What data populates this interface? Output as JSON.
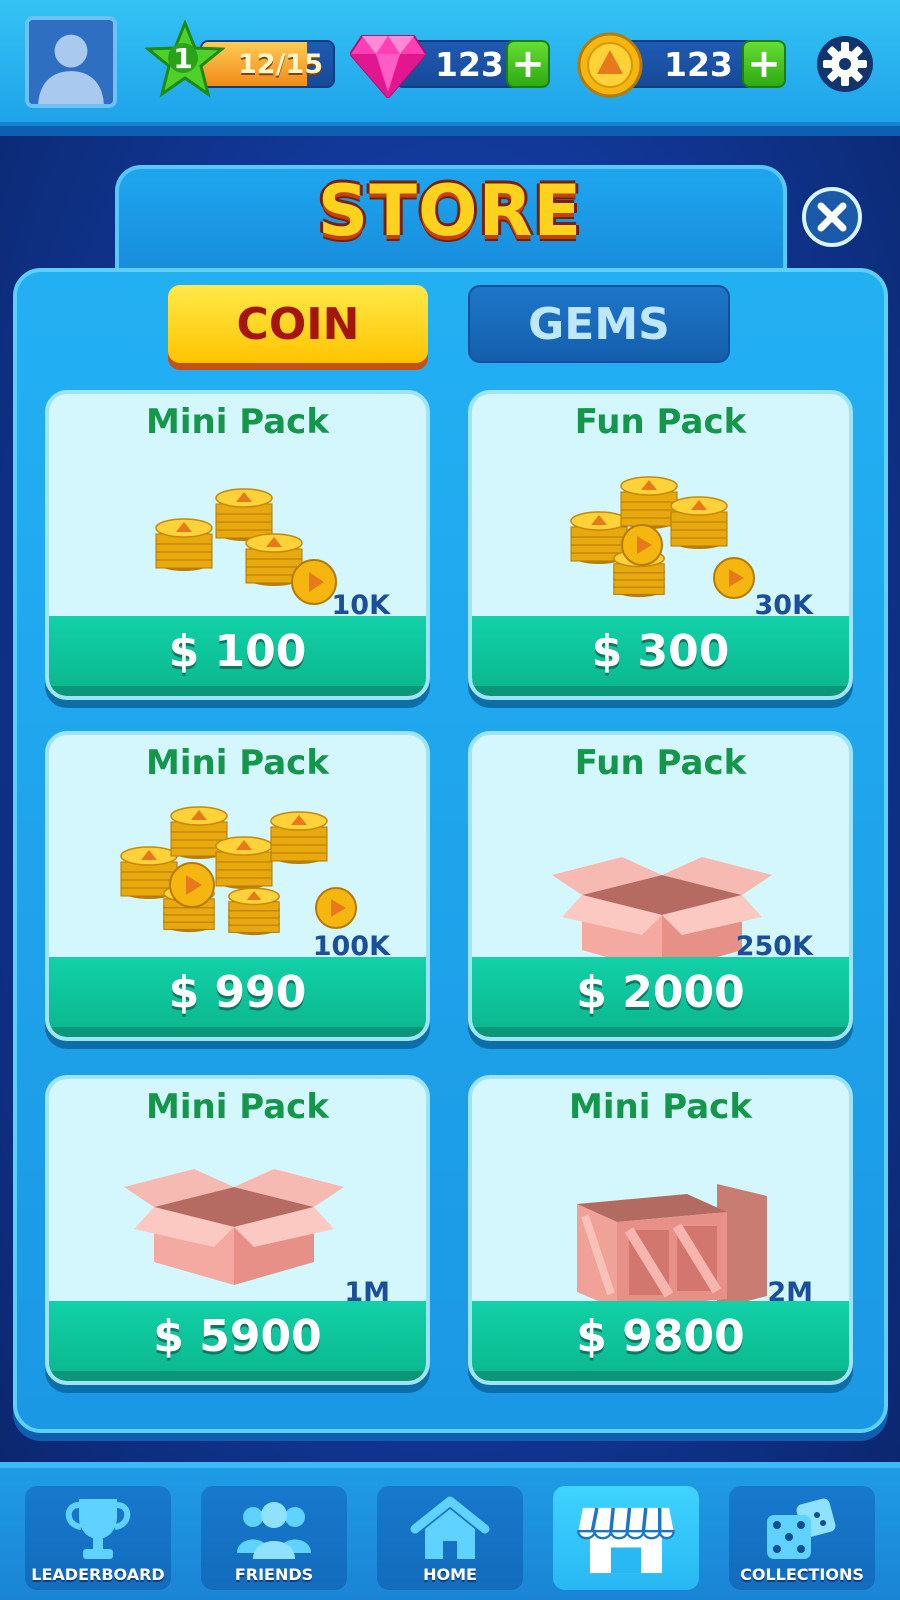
{
  "topbar": {
    "level": "1",
    "xp_text": "12/15",
    "xp_progress": 0.8,
    "gems": "123",
    "coins": "123",
    "add_label": "+"
  },
  "store": {
    "title": "STORE",
    "tabs": [
      {
        "label": "COIN",
        "active": true
      },
      {
        "label": "GEMS",
        "active": false
      }
    ],
    "packs": [
      {
        "title": "Mini Pack",
        "amount": "10K",
        "price": "$ 100",
        "art": "coin-stack-small-icon"
      },
      {
        "title": "Fun Pack",
        "amount": "30K",
        "price": "$ 300",
        "art": "coin-stack-medium-icon"
      },
      {
        "title": "Mini Pack",
        "amount": "100K",
        "price": "$ 990",
        "art": "coin-pile-large-icon"
      },
      {
        "title": "Fun Pack",
        "amount": "250K",
        "price": "$ 2000",
        "art": "open-box-icon"
      },
      {
        "title": "Mini Pack",
        "amount": "1M",
        "price": "$ 5900",
        "art": "open-box-icon"
      },
      {
        "title": "Mini Pack",
        "amount": "2M",
        "price": "$ 9800",
        "art": "wooden-crate-icon"
      }
    ]
  },
  "nav": [
    {
      "label": "LEADERBOARD",
      "icon": "trophy-icon",
      "active": false
    },
    {
      "label": "FRIENDS",
      "icon": "friends-icon",
      "active": false
    },
    {
      "label": "HOME",
      "icon": "home-icon",
      "active": false
    },
    {
      "label": "",
      "icon": "store-icon",
      "active": true
    },
    {
      "label": "COLLECTIONS",
      "icon": "dice-icon",
      "active": false
    }
  ],
  "colors": {
    "sky": "#1ea3ea",
    "navy": "#0b2a78",
    "gold": "#ffd21e",
    "green_price": "#12d1a8",
    "pack_title": "#14974a"
  }
}
